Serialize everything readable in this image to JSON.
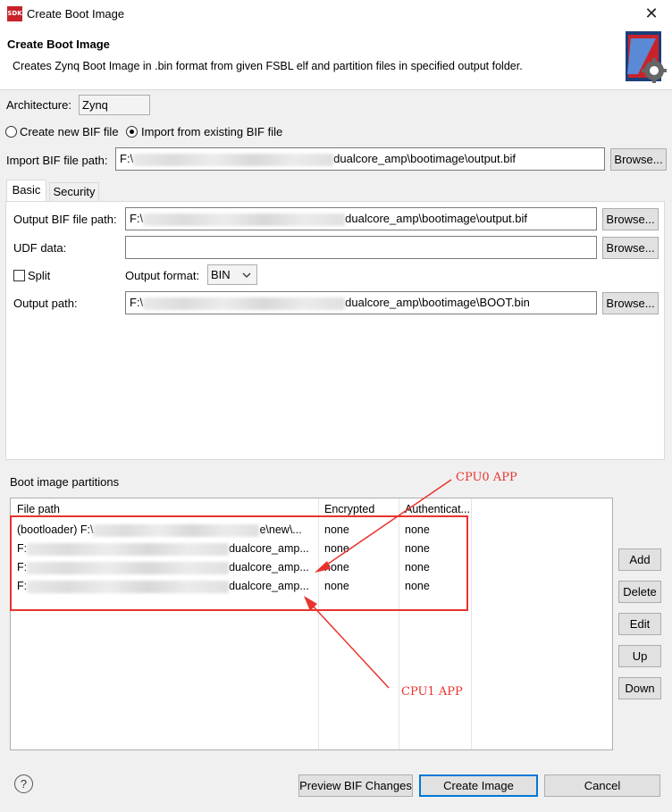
{
  "window": {
    "title": "Create Boot Image",
    "icon_text": "SDK",
    "close_icon": "close-icon"
  },
  "header": {
    "title": "Create Boot Image",
    "description": "Creates Zynq Boot Image in .bin format from given FSBL elf and partition files in specified output folder."
  },
  "architecture": {
    "label": "Architecture:",
    "value": "Zynq"
  },
  "bif_mode": {
    "create_label": "Create new BIF file",
    "import_label": "Import from existing BIF file",
    "selected": "import"
  },
  "import_bif": {
    "label": "Import BIF file path:",
    "value_prefix": "F:\\",
    "value_suffix": "dualcore_amp\\bootimage\\output.bif",
    "browse": "Browse..."
  },
  "tabs": [
    {
      "label": "Basic"
    },
    {
      "label": "Security"
    }
  ],
  "basic": {
    "output_bif": {
      "label": "Output BIF file path:",
      "value_prefix": "F:\\",
      "value_suffix": "dualcore_amp\\bootimage\\output.bif",
      "browse": "Browse..."
    },
    "udf": {
      "label": "UDF data:",
      "value": "",
      "browse": "Browse..."
    },
    "split": {
      "label": "Split",
      "checked": false
    },
    "output_format": {
      "label": "Output format:",
      "value": "BIN"
    },
    "output_path": {
      "label": "Output path:",
      "value_prefix": "F:\\",
      "value_suffix": "dualcore_amp\\bootimage\\BOOT.bin",
      "browse": "Browse..."
    }
  },
  "partitions": {
    "title": "Boot image partitions",
    "columns": [
      "File path",
      "Encrypted",
      "Authenticat..."
    ],
    "rows": [
      {
        "prefix": "(bootloader) F:\\",
        "suffix": "e\\new\\...",
        "encrypted": "none",
        "authentication": "none"
      },
      {
        "prefix": "F:",
        "suffix": "dualcore_amp...",
        "encrypted": "none",
        "authentication": "none"
      },
      {
        "prefix": "F:",
        "suffix": "dualcore_amp...",
        "encrypted": "none",
        "authentication": "none"
      },
      {
        "prefix": "F:",
        "suffix": "dualcore_amp...",
        "encrypted": "none",
        "authentication": "none"
      }
    ],
    "buttons": {
      "add": "Add",
      "delete": "Delete",
      "edit": "Edit",
      "up": "Up",
      "down": "Down"
    }
  },
  "annotations": {
    "cpu0": "CPU0 APP",
    "cpu1": "CPU1 APP",
    "color": "#e8332e"
  },
  "footer": {
    "help": "?",
    "preview": "Preview BIF Changes",
    "create": "Create Image",
    "cancel": "Cancel"
  }
}
